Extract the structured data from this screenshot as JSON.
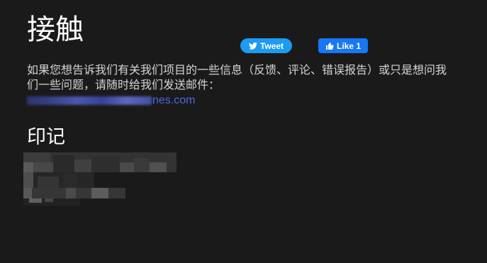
{
  "contact": {
    "heading": "接触",
    "description": "如果您想告诉我们有关我们项目的一些信息（反馈、评论、错误报告）或只是想问我们一些问题，请随时给我们发送邮件：",
    "email_visible_part": "nes.com"
  },
  "social": {
    "tweet_label": "Tweet",
    "like_label": "Like 1"
  },
  "imprint": {
    "heading": "印记"
  },
  "colors": {
    "background": "#1a1a1a",
    "link": "#4d68e6",
    "tweet": "#1d9bf0",
    "facebook": "#1877f2"
  }
}
